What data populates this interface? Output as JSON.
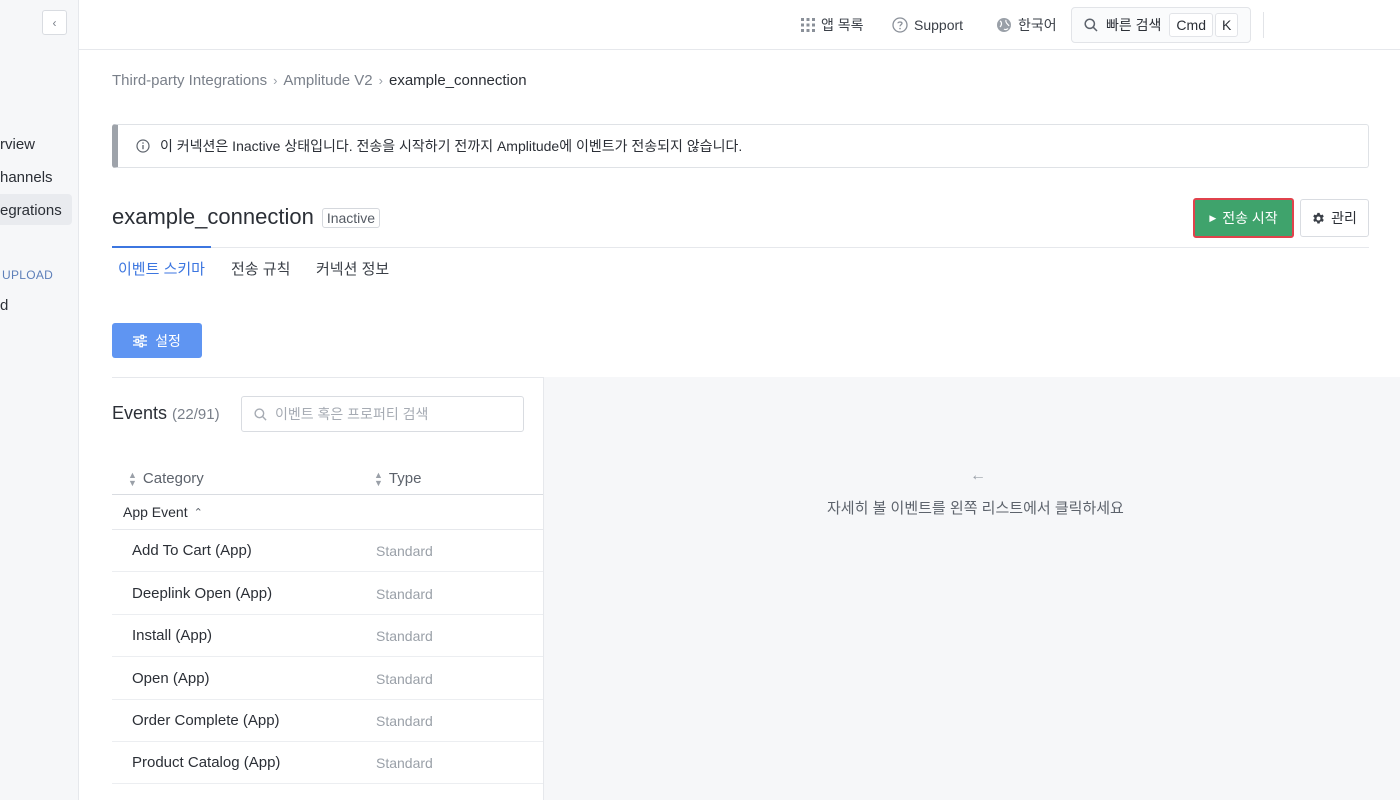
{
  "sidebar": {
    "items": [
      {
        "label": "rview",
        "active": false
      },
      {
        "label": "hannels",
        "active": false
      },
      {
        "label": "egrations",
        "active": true
      }
    ],
    "section_label": "UPLOAD",
    "section_item": "d"
  },
  "topbar": {
    "apps_label": "앱 목록",
    "support_label": "Support",
    "language_label": "한국어",
    "quick_search_label": "빠른 검색",
    "shortcut_key1": "Cmd",
    "shortcut_key2": "K"
  },
  "breadcrumb": {
    "items": [
      "Third-party Integrations",
      "Amplitude V2",
      "example_connection"
    ]
  },
  "alert": {
    "message": "이 커넥션은 Inactive 상태입니다. 전송을 시작하기 전까지 Amplitude에 이벤트가 전송되지 않습니다."
  },
  "connection": {
    "title": "example_connection",
    "status": "Inactive"
  },
  "actions": {
    "start_label": "전송 시작",
    "manage_label": "관리"
  },
  "tabs": [
    {
      "label": "이벤트 스키마",
      "active": true
    },
    {
      "label": "전송 규칙",
      "active": false
    },
    {
      "label": "커넥션 정보",
      "active": false
    }
  ],
  "settings_label": "설정",
  "events": {
    "title": "Events",
    "count": "(22/91)",
    "search_placeholder": "이벤트 혹은 프로퍼티 검색",
    "columns": [
      "Category",
      "Type"
    ],
    "group": "App Event",
    "rows": [
      {
        "name": "Add To Cart (App)",
        "type": "Standard"
      },
      {
        "name": "Deeplink Open (App)",
        "type": "Standard"
      },
      {
        "name": "Install (App)",
        "type": "Standard"
      },
      {
        "name": "Open (App)",
        "type": "Standard"
      },
      {
        "name": "Order Complete (App)",
        "type": "Standard"
      },
      {
        "name": "Product Catalog (App)",
        "type": "Standard"
      }
    ]
  },
  "detail": {
    "empty_message": "자세히 볼 이벤트를 왼쪽 리스트에서 클릭하세요"
  },
  "colors": {
    "accent": "#3c76e0",
    "start_button": "#3fa36c",
    "settings_button": "#5f95f2"
  }
}
